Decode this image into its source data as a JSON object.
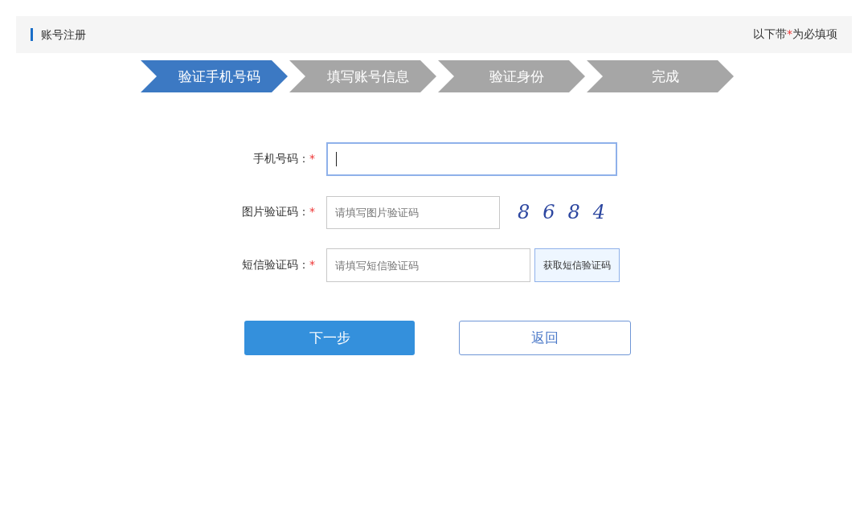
{
  "header": {
    "title": "账号注册",
    "note": {
      "before": "以下带",
      "mark": "*",
      "after": "为必填项"
    }
  },
  "steps": [
    {
      "label": "验证手机号码",
      "selected": true
    },
    {
      "label": "填写账号信息",
      "selected": false
    },
    {
      "label": "验证身份",
      "selected": false
    },
    {
      "label": "完成",
      "selected": false
    }
  ],
  "fields": [
    {
      "kind": "text",
      "label": "手机号码：",
      "required": "*",
      "focused": true
    },
    {
      "kind": "captcha",
      "label": "图片验证码：",
      "required": "*",
      "placeholder": "请填写图片验证码",
      "focused": false,
      "captcha": "8684"
    },
    {
      "kind": "sms",
      "label": "短信验证码：",
      "required": "*",
      "placeholder": "请填写短信验证码",
      "focused": false,
      "button": "获取短信验证码"
    }
  ],
  "buttons": [
    {
      "kind": "primary",
      "label": "下一步"
    },
    {
      "kind": "secondary",
      "label": "返回"
    }
  ]
}
